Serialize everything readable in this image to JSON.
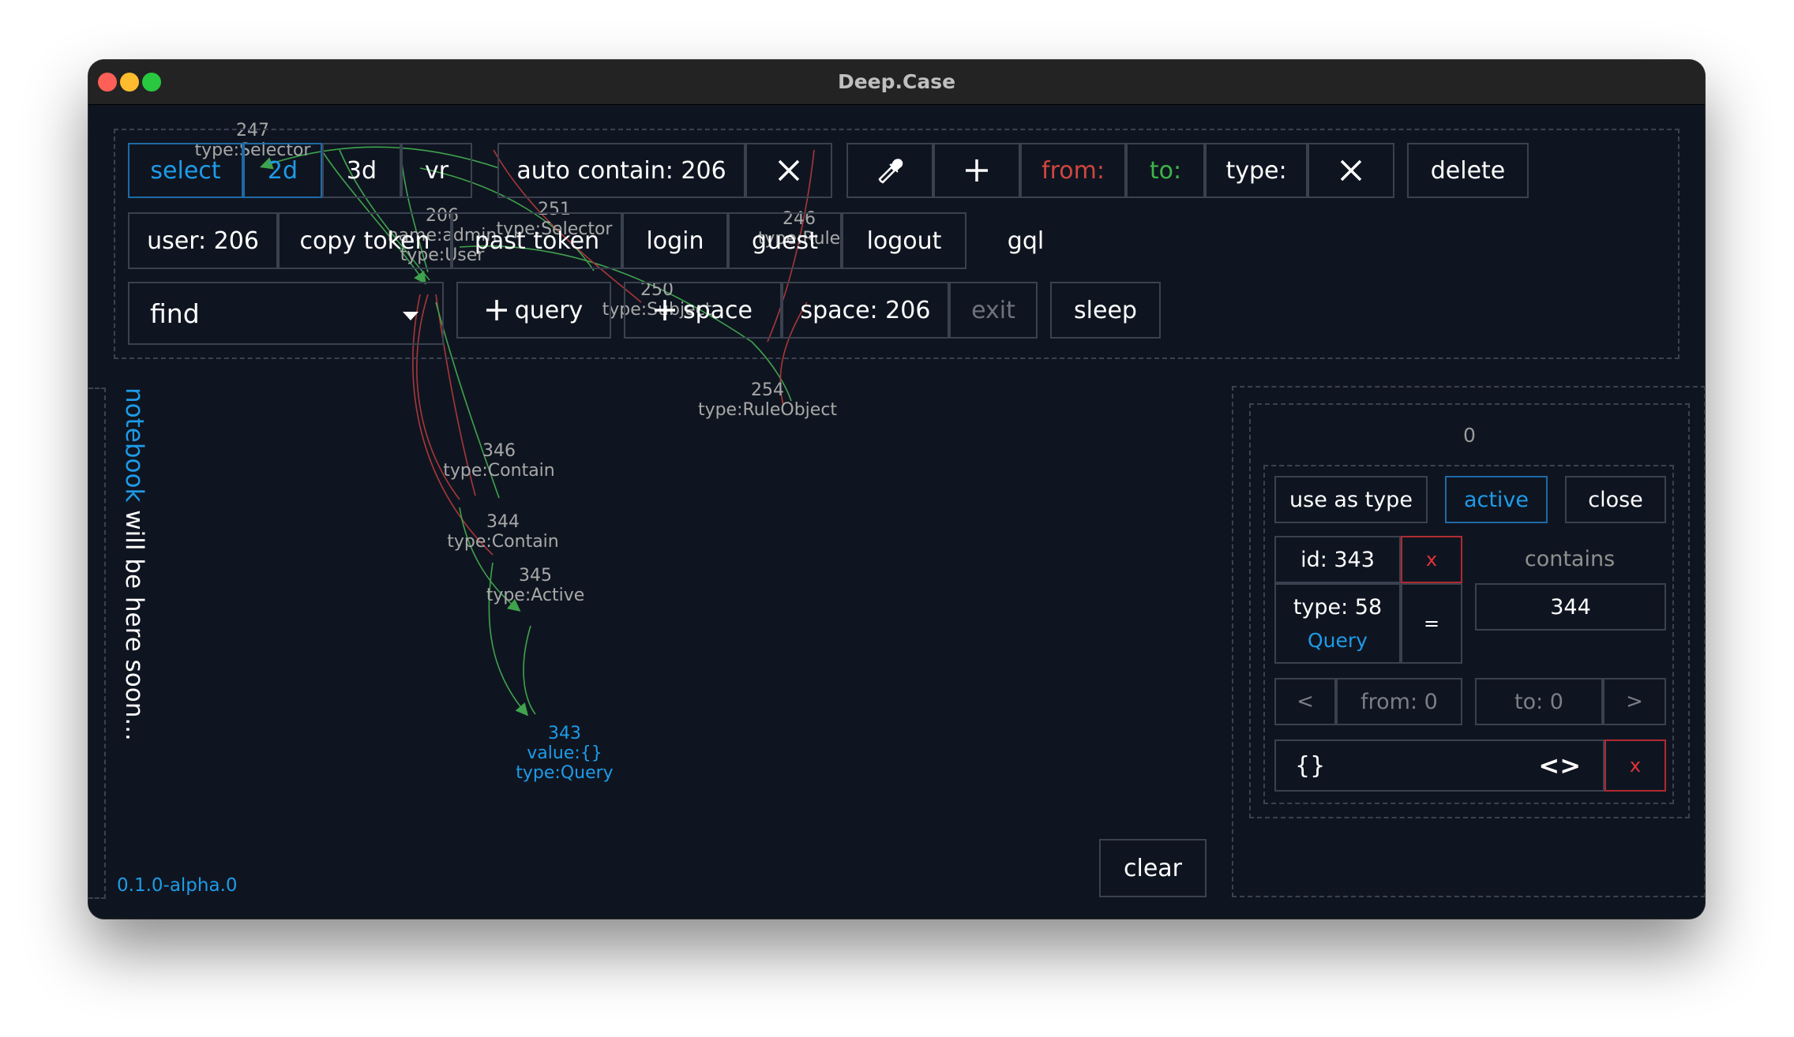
{
  "window": {
    "title": "Deep.Case"
  },
  "toolbar": {
    "row1": {
      "select": "select",
      "mode_2d": "2d",
      "mode_3d": "3d",
      "vr": "vr",
      "auto_contain": "auto contain: 206",
      "from": "from:",
      "to": "to:",
      "type": "type:",
      "delete": "delete"
    },
    "row2": {
      "user": "user: 206",
      "copy_token": "copy token",
      "past_token": "past token",
      "login": "login",
      "guest": "guest",
      "logout": "logout",
      "gql": "gql"
    },
    "row3": {
      "find": "find",
      "query": "query",
      "space": "space",
      "space_id": "space: 206",
      "exit": "exit",
      "sleep": "sleep"
    }
  },
  "graph_nodes": [
    {
      "id": "247",
      "type": "type:Selector"
    },
    {
      "id": "206",
      "name": "name:admin",
      "type": "type:User"
    },
    {
      "id": "251",
      "type": "type:Selector"
    },
    {
      "id": "246",
      "type": "type:Rule"
    },
    {
      "id": "250",
      "type": "type:Subject"
    },
    {
      "id": "254",
      "type": "type:RuleObject"
    },
    {
      "id": "346",
      "type": "type:Contain"
    },
    {
      "id": "344",
      "type": "type:Contain"
    },
    {
      "id": "345",
      "type": "type:Active"
    },
    {
      "id": "343",
      "value": "value:{}",
      "type": "type:Query"
    }
  ],
  "sidebar": {
    "notebook_word": "notebook",
    "notebook_rest": " will be here soon...",
    "version": "0.1.0-alpha.0"
  },
  "clear_button": "clear",
  "panel": {
    "header": "0",
    "use_as_type": "use as type",
    "active": "active",
    "close": "close",
    "id": "id: 343",
    "remove": "x",
    "contains_label": "contains",
    "contains_value": "344",
    "type": "type: 58",
    "type_name": "Query",
    "equals": "=",
    "prev": "<",
    "from": "from: 0",
    "to": "to: 0",
    "next": ">",
    "value": "{}",
    "code_toggle": "<>",
    "value_remove": "x"
  },
  "colors": {
    "background": "#0f1520",
    "accent_blue": "#1e9be9",
    "from_red": "#d0463d",
    "to_green": "#3db547",
    "danger_red": "#e0333b",
    "edge_green": "#3fa34d",
    "edge_red": "#a8373a"
  }
}
